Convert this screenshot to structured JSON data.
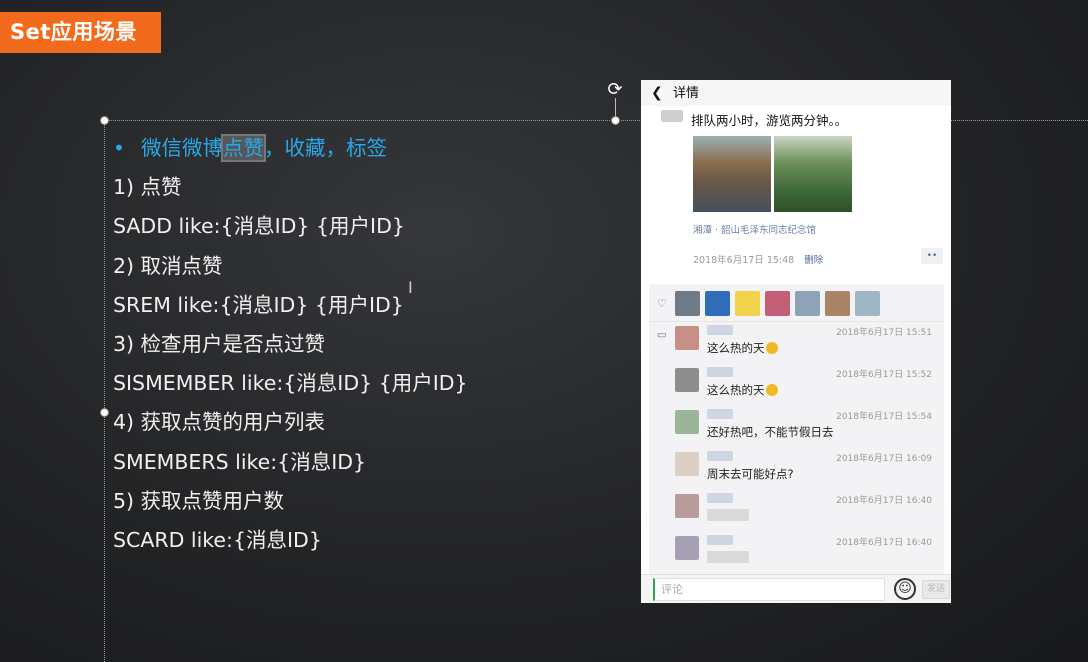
{
  "slide": {
    "title": "Set应用场景",
    "bullet": {
      "pre": "微信微博",
      "highlight": "点赞",
      "post": "，收藏，标签"
    },
    "lines": [
      "1) 点赞",
      "SADD  like:{消息ID}  {用户ID}",
      "2) 取消点赞",
      "SREM like:{消息ID}  {用户ID}",
      "3) 检查用户是否点过赞",
      "SISMEMBER  like:{消息ID}  {用户ID}",
      "4) 获取点赞的用户列表",
      "SMEMBERS like:{消息ID}",
      "5) 获取点赞用户数",
      "SCARD like:{消息ID}"
    ]
  },
  "phone": {
    "nav_title": "详情",
    "back_icon": "chevron-left-icon",
    "post_text": "排队两小时，游览两分钟。。",
    "location": "湘潭 · 韶山毛泽东同志纪念馆",
    "post_time": "2018年6月17日 15:48",
    "delete_label": "删除",
    "more_label": "••",
    "like_avatar_colors": [
      "#6e7a86",
      "#2f6db8",
      "#f2d24b",
      "#c45f7a",
      "#8ea3b8",
      "#a98466",
      "#9fb6c4"
    ],
    "comments": [
      {
        "time": "2018年6月17日 15:51",
        "text": "这么热的天",
        "emoji": true,
        "avatar_color": "#c88f86"
      },
      {
        "time": "2018年6月17日 15:52",
        "text": "这么热的天",
        "emoji": true,
        "avatar_color": "#8d8d8d"
      },
      {
        "time": "2018年6月17日 15:54",
        "text": "还好热吧，不能节假日去",
        "emoji": false,
        "avatar_color": "#9bb59a"
      },
      {
        "time": "2018年6月17日 16:09",
        "text": "周末去可能好点?",
        "emoji": false,
        "avatar_color": "#d9cfc2"
      },
      {
        "time": "2018年6月17日 16:40",
        "text": "",
        "emoji": false,
        "avatar_color": "#b89c9c"
      },
      {
        "time": "2018年6月17日 16:40",
        "text": "",
        "emoji": false,
        "avatar_color": "#a7a0b4"
      }
    ],
    "input_placeholder": "评论",
    "send_label": "发送"
  }
}
